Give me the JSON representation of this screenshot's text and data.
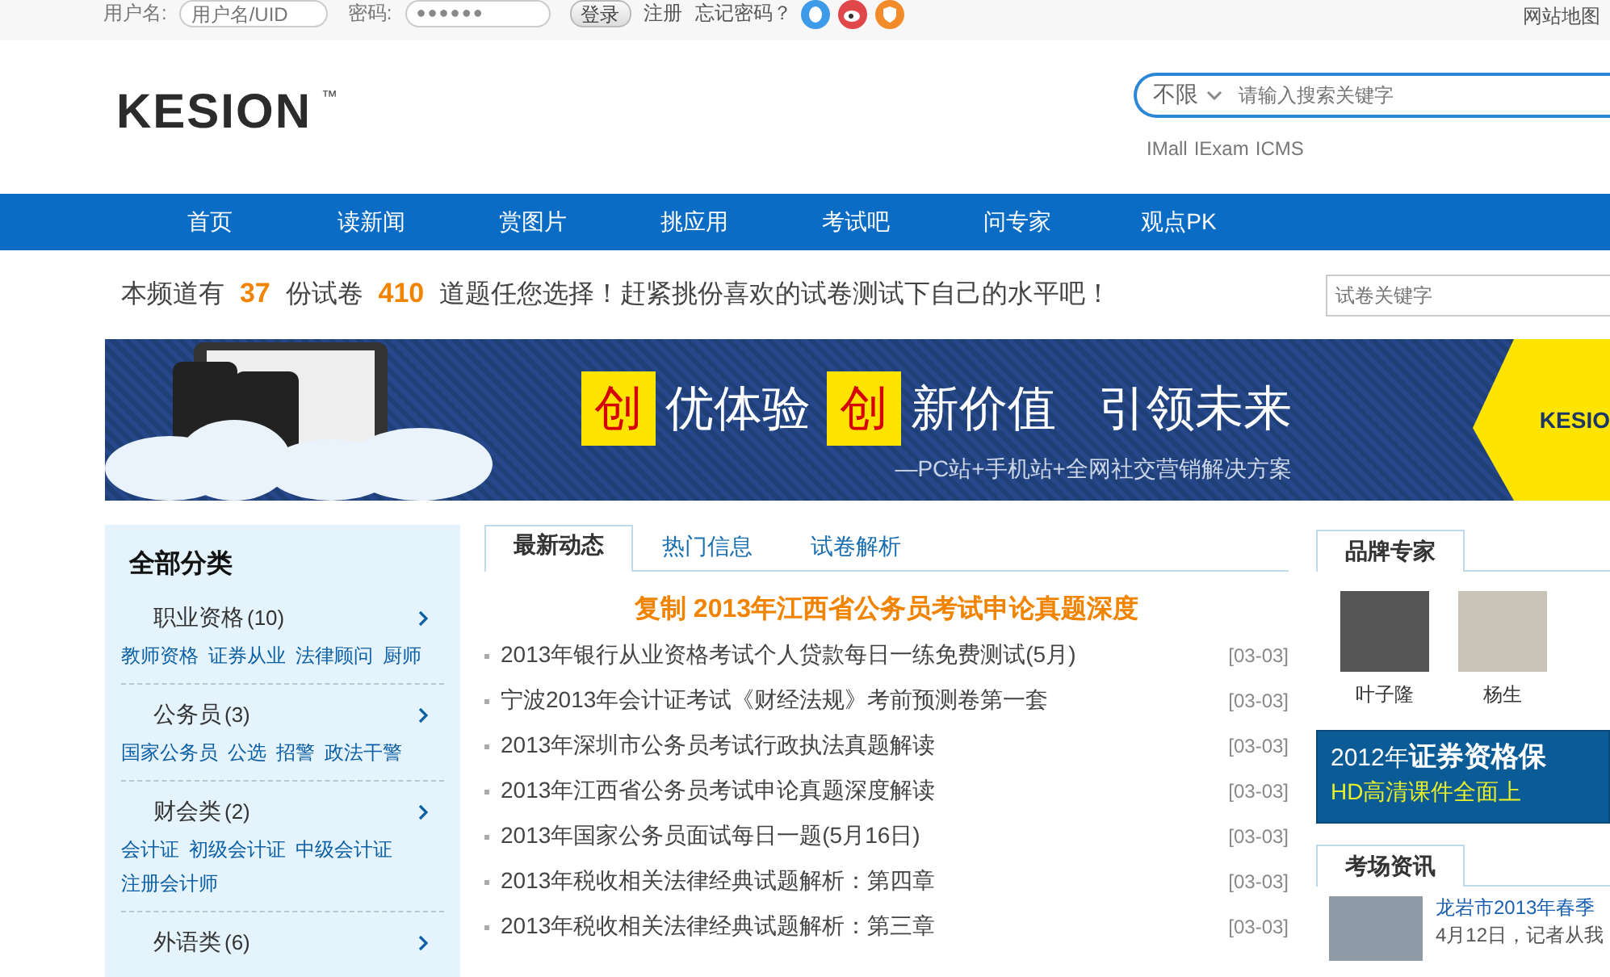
{
  "top_bar": {
    "username_label": "用户名:",
    "username_placeholder": "用户名/UID",
    "password_label": "密码:",
    "password_value": "●●●●●●",
    "login_button": "登录",
    "register_link": "注册",
    "forgot_link": "忘记密码？",
    "site_map": "网站地图"
  },
  "header": {
    "logo": "KESION",
    "logo_mark": "™",
    "search_scope": "不限",
    "search_placeholder": "请输入搜索关键字",
    "quick_links": [
      "IMall",
      "IExam",
      "ICMS"
    ]
  },
  "nav": [
    "首页",
    "读新闻",
    "赏图片",
    "挑应用",
    "考试吧",
    "问专家",
    "观点PK"
  ],
  "info": {
    "text": "本频道有 **37** 份试卷 **410** 道题任您选择！赶紧挑份喜欢的试卷测试下自己的水平吧！",
    "search_placeholder": "试卷关键字"
  },
  "banner": {
    "highlights": [
      "创",
      "创"
    ],
    "slogans": [
      "优体验",
      "新价值",
      "引领未来"
    ],
    "subtitle": "—PC站+手机站+全网社交营销解决方案",
    "brand": "KESIO"
  },
  "sidebar": {
    "title": "全部分类",
    "categories": [
      {
        "name": "职业资格",
        "count": "(10)",
        "links": [
          "教师资格",
          "证券从业",
          "法律顾问",
          "厨师"
        ]
      },
      {
        "name": "公务员",
        "count": "(3)",
        "links": [
          "国家公务员",
          "公选",
          "招警",
          "政法干警"
        ]
      },
      {
        "name": "财会类",
        "count": "(2)",
        "links": [
          "会计证",
          "初级会计证",
          "中级会计证",
          "注册会计师"
        ]
      },
      {
        "name": "外语类",
        "count": "(6)"
      }
    ]
  },
  "news": {
    "tabs": [
      {
        "label": "最新动态",
        "selected": true
      },
      {
        "label": "热门信息",
        "selected": false
      },
      {
        "label": "试卷解析",
        "selected": false
      }
    ],
    "headline": "复制 2013年江西省公务员考试申论真题深度",
    "items": [
      {
        "title": "2013年银行从业资格考试个人贷款每日一练免费测试(5月)",
        "date": "[03-03]"
      },
      {
        "title": "宁波2013年会计证考试《财经法规》考前预测卷第一套",
        "date": "[03-03]"
      },
      {
        "title": "2013年深圳市公务员考试行政执法真题解读",
        "date": "[03-03]"
      },
      {
        "title": "2013年江西省公务员考试申论真题深度解读",
        "date": "[03-03]"
      },
      {
        "title": "2013年国家公务员面试每日一题(5月16日)",
        "date": "[03-03]"
      },
      {
        "title": "2013年税收相关法律经典试题解析：第四章",
        "date": "[03-03]"
      },
      {
        "title": "2013年税收相关法律经典试题解析：第三章",
        "date": "[03-03]"
      }
    ]
  },
  "experts": {
    "tab": "品牌专家",
    "people": [
      "叶子隆",
      "杨生"
    ]
  },
  "ad": {
    "line_1": "2012年",
    "line_1_bold": "证券资格保",
    "line_2": "HD高清课件全面上"
  },
  "exam_news": {
    "tab": "考场资讯",
    "title": "龙岩市2013年春季",
    "summary": "4月12日，记者从我"
  }
}
